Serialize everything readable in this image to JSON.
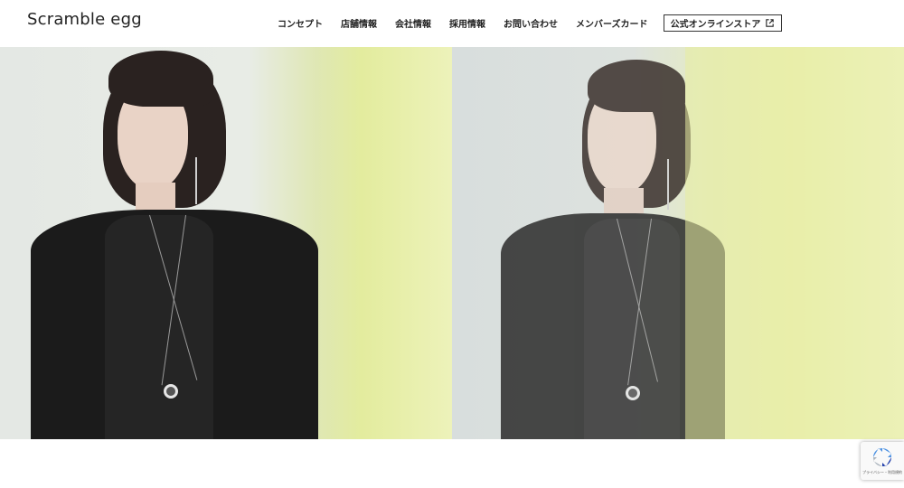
{
  "header": {
    "logo": "Scramble egg",
    "nav": [
      {
        "label": "コンセプト"
      },
      {
        "label": "店舗情報"
      },
      {
        "label": "会社情報"
      },
      {
        "label": "採用情報"
      },
      {
        "label": "お問い合わせ"
      },
      {
        "label": "メンバーズカード"
      }
    ],
    "store_button": "公式オンラインストア",
    "store_icon": "external-link-icon"
  },
  "hero": {
    "left_image": "model-photo",
    "right_image": "model-photo-faded"
  },
  "recaptcha": {
    "links": "プライバシー・利用規約",
    "icon": "recaptcha-logo-icon"
  },
  "colors": {
    "background": "#ffffff",
    "text": "#222222",
    "hero_yellow": "#e3ec9e",
    "hero_gray": "#e4e8e4",
    "garment": "#1b1b1b"
  }
}
